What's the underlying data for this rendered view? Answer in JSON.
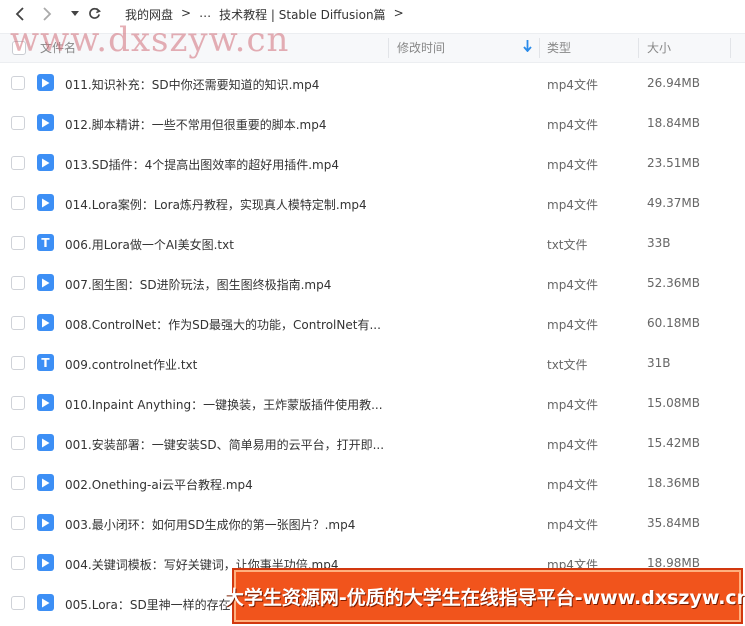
{
  "toolbar": {
    "back_icon": "chevron-left-icon",
    "forward_icon": "chevron-right-icon",
    "dropdown_icon": "caret-down-icon",
    "refresh_icon": "refresh-icon",
    "breadcrumbs": [
      "我的网盘",
      ">",
      "…",
      "技术教程 | Stable Diffusion篇",
      ">"
    ]
  },
  "watermark_top": "www.dxszyw.cn",
  "header": {
    "name": "文件名",
    "modified": "修改时间",
    "type": "类型",
    "size": "大小",
    "sort_icon": "sort-down-arrow-icon",
    "accent": "#2a8bea"
  },
  "files": [
    {
      "name": "011.知识补充：SD中你还需要知道的知识.mp4",
      "type": "mp4文件",
      "size": "26.94MB",
      "icon": "video-file-icon"
    },
    {
      "name": "012.脚本精讲：一些不常用但很重要的脚本.mp4",
      "type": "mp4文件",
      "size": "18.84MB",
      "icon": "video-file-icon"
    },
    {
      "name": "013.SD插件：4个提高出图效率的超好用插件.mp4",
      "type": "mp4文件",
      "size": "23.51MB",
      "icon": "video-file-icon"
    },
    {
      "name": "014.Lora案例：Lora炼丹教程，实现真人模特定制.mp4",
      "type": "mp4文件",
      "size": "49.37MB",
      "icon": "video-file-icon"
    },
    {
      "name": "006.用Lora做一个AI美女图.txt",
      "type": "txt文件",
      "size": "33B",
      "icon": "text-file-icon"
    },
    {
      "name": "007.图生图：SD进阶玩法，图生图终极指南.mp4",
      "type": "mp4文件",
      "size": "52.36MB",
      "icon": "video-file-icon"
    },
    {
      "name": "008.ControlNet：作为SD最强大的功能，ControlNet有...",
      "type": "mp4文件",
      "size": "60.18MB",
      "icon": "video-file-icon"
    },
    {
      "name": "009.controlnet作业.txt",
      "type": "txt文件",
      "size": "31B",
      "icon": "text-file-icon"
    },
    {
      "name": "010.Inpaint Anything：一键换装，王炸蒙版插件使用教...",
      "type": "mp4文件",
      "size": "15.08MB",
      "icon": "video-file-icon"
    },
    {
      "name": "001.安装部署：一键安装SD、简单易用的云平台，打开即...",
      "type": "mp4文件",
      "size": "15.42MB",
      "icon": "video-file-icon"
    },
    {
      "name": "002.Onething-ai云平台教程.mp4",
      "type": "mp4文件",
      "size": "18.36MB",
      "icon": "video-file-icon"
    },
    {
      "name": "003.最小闭环：如何用SD生成你的第一张图片？.mp4",
      "type": "mp4文件",
      "size": "35.84MB",
      "icon": "video-file-icon"
    },
    {
      "name": "004.关键词模板：写好关键词，让你事半功倍.mp4",
      "type": "mp4文件",
      "size": "18.98MB",
      "icon": "video-file-icon"
    },
    {
      "name": "005.Lora：SD里神一样的存在，",
      "type": "",
      "size": "",
      "icon": "video-file-icon"
    }
  ],
  "banner": {
    "text": "大学生资源网-优质的大学生在线指导平台-www.dxszyw.cn",
    "bg_color": "#f1541c"
  }
}
